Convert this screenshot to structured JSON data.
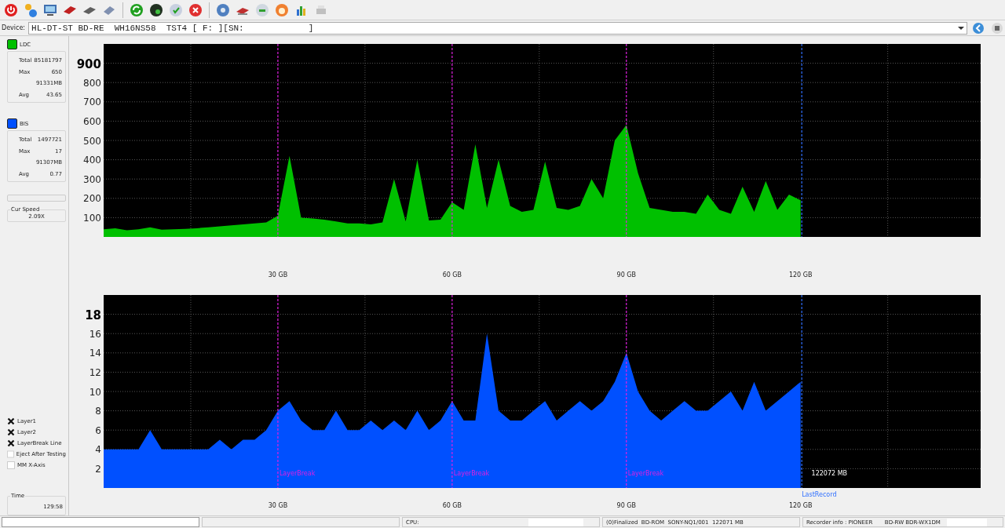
{
  "device": {
    "label": "Device:",
    "value": "HL-DT-ST BD-RE  WH16NS58  TST4 [ F: ][SN:",
    "value_end": "]"
  },
  "stats": [
    {
      "rows": [
        {
          "label": "Total",
          "value": "85181797"
        },
        {
          "label": "Max",
          "value": "650"
        },
        {
          "label": "",
          "value": "91331MB"
        },
        {
          "label": "Avg",
          "value": "43.65"
        }
      ]
    },
    {
      "rows": [
        {
          "label": "Total",
          "value": "1497721"
        },
        {
          "label": "Max",
          "value": "17"
        },
        {
          "label": "",
          "value": "91307MB"
        },
        {
          "label": "Avg",
          "value": "0.77"
        }
      ]
    }
  ],
  "progress": {
    "level": 0
  },
  "speed": {
    "label": "Cur Speed",
    "value": "2.09X"
  },
  "options": [
    {
      "label": "Layer1",
      "checked": true
    },
    {
      "label": "Layer2",
      "checked": true
    },
    {
      "label": "LayerBreak Line",
      "checked": true
    },
    {
      "label": "Eject After Testing",
      "checked": false
    },
    {
      "label": "MM X-Axis",
      "checked": false
    }
  ],
  "time": {
    "label": "Time",
    "value": "129:58"
  },
  "charts": [
    {
      "chart_data": {
        "type": "area",
        "x": [
          0,
          2,
          4,
          6,
          8,
          10,
          12,
          14,
          16,
          18,
          20,
          22,
          24,
          26,
          28,
          30,
          32,
          34,
          36,
          38,
          40,
          42,
          44,
          46,
          48,
          50,
          52,
          54,
          56,
          58,
          60,
          62,
          64,
          66,
          68,
          70,
          72,
          74,
          76,
          78,
          80,
          82,
          84,
          86,
          88,
          90,
          92,
          94,
          96,
          98,
          100,
          102,
          104,
          106,
          108,
          110,
          112,
          114,
          116,
          118,
          120
        ],
        "series": [
          {
            "name": "LDC",
            "color": "#00c000",
            "values": [
              40,
              45,
              35,
              40,
              50,
              38,
              40,
              42,
              45,
              50,
              55,
              60,
              65,
              70,
              75,
              110,
              420,
              100,
              95,
              90,
              80,
              70,
              70,
              65,
              75,
              300,
              80,
              400,
              85,
              90,
              180,
              140,
              480,
              150,
              400,
              160,
              130,
              140,
              390,
              150,
              140,
              160,
              300,
              200,
              500,
              580,
              330,
              150,
              140,
              130,
              130,
              120,
              220,
              140,
              120,
              260,
              130,
              290,
              140,
              220,
              190
            ]
          }
        ],
        "xlim": [
          0,
          151
        ],
        "ylim": [
          0,
          1000
        ],
        "xticks": [
          {
            "value": 30,
            "label": "30 GB"
          },
          {
            "value": 60,
            "label": "60 GB"
          },
          {
            "value": 90,
            "label": "90 GB"
          },
          {
            "value": 120,
            "label": "120 GB"
          }
        ],
        "yticks": [
          100,
          200,
          300,
          400,
          500,
          600,
          700,
          800,
          900
        ],
        "grid": true,
        "ref_lines": [
          {
            "axis": "x",
            "value": 30,
            "color": "#e020e0"
          },
          {
            "axis": "x",
            "value": 60,
            "color": "#e020e0"
          },
          {
            "axis": "x",
            "value": 90,
            "color": "#e020e0"
          },
          {
            "axis": "x",
            "value": 120.2,
            "color": "#3070ff"
          }
        ]
      }
    },
    {
      "chart_data": {
        "type": "area",
        "x": [
          0,
          2,
          4,
          6,
          8,
          10,
          12,
          14,
          16,
          18,
          20,
          22,
          24,
          26,
          28,
          30,
          32,
          34,
          36,
          38,
          40,
          42,
          44,
          46,
          48,
          50,
          52,
          54,
          56,
          58,
          60,
          62,
          64,
          66,
          68,
          70,
          72,
          74,
          76,
          78,
          80,
          82,
          84,
          86,
          88,
          90,
          92,
          94,
          96,
          98,
          100,
          102,
          104,
          106,
          108,
          110,
          112,
          114,
          116,
          118,
          120
        ],
        "series": [
          {
            "name": "BIS",
            "color": "#0050ff",
            "values": [
              4,
              4,
              4,
              4,
              6,
              4,
              4,
              4,
              4,
              4,
              5,
              4,
              5,
              5,
              6,
              8,
              9,
              7,
              6,
              6,
              8,
              6,
              6,
              7,
              6,
              7,
              6,
              8,
              6,
              7,
              9,
              7,
              7,
              16,
              8,
              7,
              7,
              8,
              9,
              7,
              8,
              9,
              8,
              9,
              11,
              14,
              10,
              8,
              7,
              8,
              9,
              8,
              8,
              9,
              10,
              8,
              11,
              8,
              9,
              10,
              11
            ]
          }
        ],
        "xlim": [
          0,
          151
        ],
        "ylim": [
          0,
          20
        ],
        "xticks": [
          {
            "value": 30,
            "label": "30 GB"
          },
          {
            "value": 60,
            "label": "60 GB"
          },
          {
            "value": 90,
            "label": "90 GB"
          },
          {
            "value": 120,
            "label": "120 GB"
          }
        ],
        "yticks": [
          2,
          4,
          6,
          8,
          10,
          12,
          14,
          16,
          18
        ],
        "grid": true,
        "ref_lines": [
          {
            "axis": "x",
            "value": 30,
            "color": "#e020e0",
            "label": "LayerBreak"
          },
          {
            "axis": "x",
            "value": 60,
            "color": "#e020e0",
            "label": "LayerBreak"
          },
          {
            "axis": "x",
            "value": 90,
            "color": "#e020e0",
            "label": "LayerBreak"
          },
          {
            "axis": "x",
            "value": 120.2,
            "color": "#3070ff",
            "label": "LastRecord"
          }
        ],
        "annotations": [
          "122072 MB"
        ]
      }
    }
  ],
  "status_bar": [
    {
      "kind": "field"
    },
    {
      "kind": "empty"
    },
    {
      "kind": "meter",
      "text": "CPU:"
    },
    {
      "kind": "text",
      "text": "(0)Finalized  BD-ROM  SONY-NQ1/001  122071 MB"
    },
    {
      "kind": "meter",
      "text": "Recorder info : PIONEER       BD-RW BDR-WX1DM"
    }
  ]
}
